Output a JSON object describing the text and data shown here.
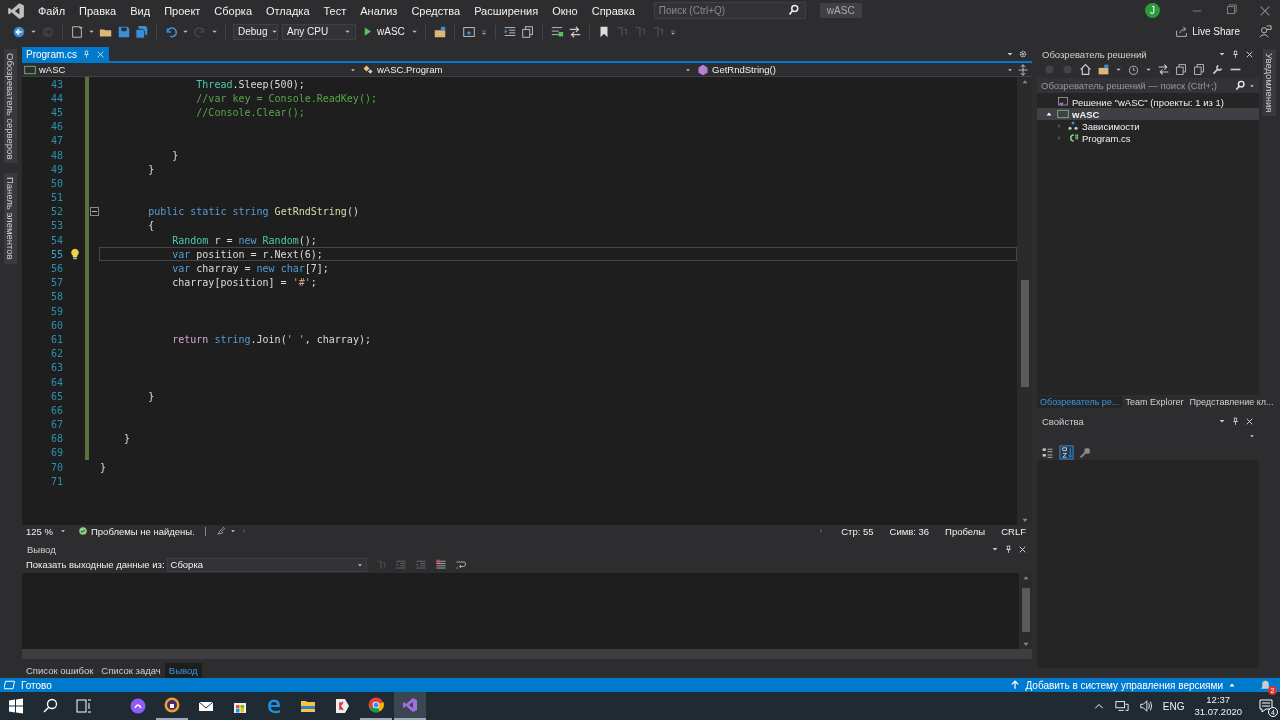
{
  "window": {
    "title": "wASC",
    "search_placeholder": "Поиск (Ctrl+Q)",
    "account_initial": "J"
  },
  "menu": [
    "Файл",
    "Правка",
    "Вид",
    "Проект",
    "Сборка",
    "Отладка",
    "Тест",
    "Анализ",
    "Средства",
    "Расширения",
    "Окно",
    "Справка"
  ],
  "toolbar": {
    "configuration": "Debug",
    "platform": "Any CPU",
    "run_target": "wASC",
    "live_share": "Live Share"
  },
  "side_tabs_left": [
    "Обозреватель серверов",
    "Панель элементов"
  ],
  "side_tabs_right": [
    "Уведомления"
  ],
  "editor": {
    "tabs": [
      {
        "label": "Program.cs",
        "selected": true
      }
    ],
    "nav": [
      "wASC",
      "wASC.Program",
      "GetRndString()"
    ],
    "lines": [
      {
        "number": "43",
        "changed": true,
        "current": false,
        "tokens": [
          {
            "text": "                Thread",
            "kind": "type"
          },
          {
            "text": ".Sleep(500);",
            "kind": "plain"
          }
        ]
      },
      {
        "number": "44",
        "changed": true,
        "current": false,
        "tokens": [
          {
            "text": "                //var key = Console.ReadKey();",
            "kind": "comment"
          }
        ]
      },
      {
        "number": "45",
        "changed": true,
        "current": false,
        "tokens": [
          {
            "text": "                //Console.Clear();",
            "kind": "comment"
          }
        ]
      },
      {
        "number": "46",
        "changed": true,
        "current": false
      },
      {
        "number": "47",
        "changed": true,
        "current": false
      },
      {
        "number": "48",
        "changed": true,
        "current": false,
        "tokens": [
          {
            "text": "            }",
            "kind": "plain"
          }
        ]
      },
      {
        "number": "49",
        "changed": true,
        "current": false,
        "tokens": [
          {
            "text": "        }",
            "kind": "plain"
          }
        ]
      },
      {
        "number": "50",
        "changed": true,
        "current": false
      },
      {
        "number": "51",
        "changed": true,
        "current": false
      },
      {
        "number": "52",
        "changed": true,
        "current": false,
        "collapsed": false,
        "tokens": [
          {
            "text": "        public static string",
            "kind": "keyword"
          },
          {
            "text": " GetRndString",
            "kind": "method"
          },
          {
            "text": "()",
            "kind": "plain"
          }
        ]
      },
      {
        "number": "53",
        "changed": true,
        "current": false,
        "tokens": [
          {
            "text": "        {",
            "kind": "plain"
          }
        ]
      },
      {
        "number": "54",
        "changed": true,
        "current": false,
        "tokens": [
          {
            "text": "            Random",
            "kind": "type"
          },
          {
            "text": " r = ",
            "kind": "plain"
          },
          {
            "text": "new",
            "kind": "keyword"
          },
          {
            "text": " Random",
            "kind": "type"
          },
          {
            "text": "();",
            "kind": "plain"
          }
        ]
      },
      {
        "number": "55",
        "changed": true,
        "current": true,
        "tokens": [
          {
            "text": "            var",
            "kind": "keyword"
          },
          {
            "text": " position = r.Next(6);",
            "kind": "plain"
          }
        ]
      },
      {
        "number": "56",
        "changed": true,
        "current": false,
        "tokens": [
          {
            "text": "            var",
            "kind": "keyword"
          },
          {
            "text": " charray = ",
            "kind": "plain"
          },
          {
            "text": "new char",
            "kind": "keyword"
          },
          {
            "text": "[7];",
            "kind": "plain"
          }
        ]
      },
      {
        "number": "57",
        "changed": true,
        "current": false,
        "tokens": [
          {
            "text": "            charray[position] = ",
            "kind": "plain"
          },
          {
            "text": "'#'",
            "kind": "string"
          },
          {
            "text": ";",
            "kind": "plain"
          }
        ]
      },
      {
        "number": "58",
        "changed": true,
        "current": false
      },
      {
        "number": "59",
        "changed": true,
        "current": false
      },
      {
        "number": "60",
        "changed": true,
        "current": false
      },
      {
        "number": "61",
        "changed": true,
        "current": false,
        "tokens": [
          {
            "text": "            return",
            "kind": "control"
          },
          {
            "text": " string",
            "kind": "keyword"
          },
          {
            "text": ".Join(",
            "kind": "plain"
          },
          {
            "text": "' '",
            "kind": "string"
          },
          {
            "text": ", charray);",
            "kind": "plain"
          }
        ]
      },
      {
        "number": "62",
        "changed": true,
        "current": false
      },
      {
        "number": "63",
        "changed": true,
        "current": false
      },
      {
        "number": "64",
        "changed": true,
        "current": false
      },
      {
        "number": "65",
        "changed": true,
        "current": false,
        "tokens": [
          {
            "text": "        }",
            "kind": "plain"
          }
        ]
      },
      {
        "number": "66",
        "changed": true,
        "current": false
      },
      {
        "number": "67",
        "changed": true,
        "current": false
      },
      {
        "number": "68",
        "changed": true,
        "current": false,
        "tokens": [
          {
            "text": "    }",
            "kind": "plain"
          }
        ]
      },
      {
        "number": "69",
        "changed": true,
        "current": false
      },
      {
        "number": "70",
        "changed": false,
        "current": false,
        "tokens": [
          {
            "text": "}",
            "kind": "plain"
          }
        ]
      },
      {
        "number": "71",
        "changed": false,
        "current": false
      }
    ],
    "zoom": "125 %",
    "issues": "Проблемы не найдены.",
    "position": [
      "Стр: 55",
      "Симв: 36",
      "Пробелы",
      "CRLF"
    ]
  },
  "output": {
    "title": "Вывод",
    "source_label": "Показать выходные данные из:",
    "source": "Сборка"
  },
  "bottom_tabs": [
    {
      "label": "Список ошибок",
      "selected": false
    },
    {
      "label": "Список задач",
      "selected": false
    },
    {
      "label": "Вывод",
      "selected": true
    }
  ],
  "solution_explorer": {
    "title": "Обозреватель решений",
    "search_placeholder": "Обозреватель решений — поиск (Ctrl+;)",
    "tree": [
      {
        "label": "Решение \"wASC\" (проекты: 1 из 1)",
        "kind": "solution",
        "selected": false,
        "children": [
          {
            "label": "wASC",
            "kind": "project",
            "expanded": true,
            "selected": true,
            "children": [
              {
                "label": "Зависимости",
                "kind": "dependencies",
                "expanded": false,
                "selected": false
              },
              {
                "label": "Program.cs",
                "kind": "csfile",
                "expanded": false,
                "selected": false
              }
            ]
          }
        ]
      }
    ]
  },
  "right_tabs": [
    {
      "label": "Обозреватель ре...",
      "selected": true
    },
    {
      "label": "Team Explorer",
      "selected": false
    },
    {
      "label": "Представление кл...",
      "selected": false
    }
  ],
  "properties": {
    "title": "Свойства"
  },
  "status_bar": {
    "text": "Готово",
    "source_control": "Добавить в систему управления версиями",
    "notifications": "2"
  },
  "taskbar": {
    "language": "ENG",
    "time": "12:37",
    "date": "31.07.2020",
    "notifications": "4"
  }
}
